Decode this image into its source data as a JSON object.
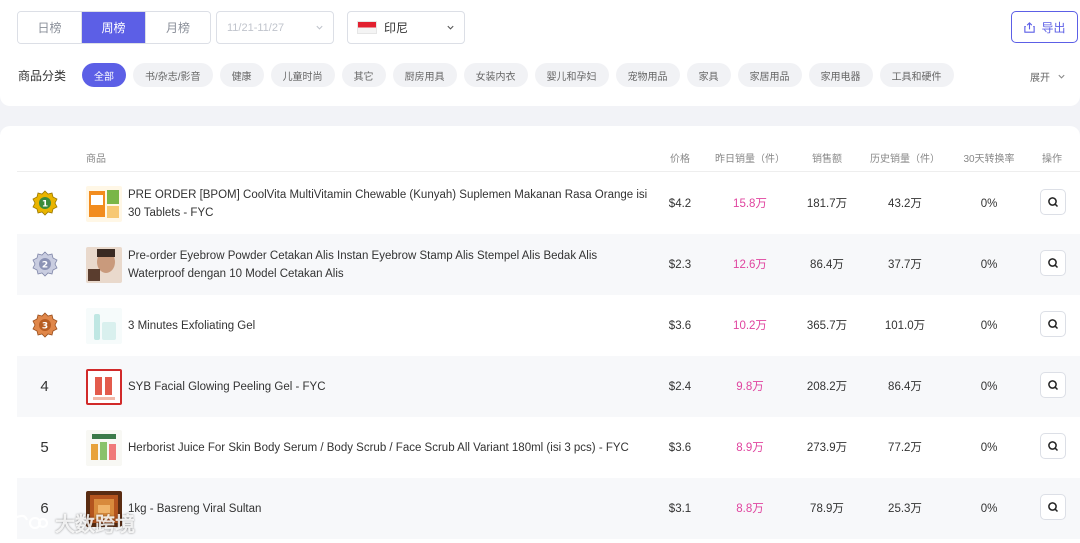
{
  "tabs": [
    {
      "label": "日榜",
      "active": false
    },
    {
      "label": "周榜",
      "active": true
    },
    {
      "label": "月榜",
      "active": false
    }
  ],
  "date_range": {
    "placeholder": "11/21-11/27"
  },
  "country": {
    "label": "印尼",
    "flag": "indonesia-flag"
  },
  "export_label": "导出",
  "category": {
    "label": "商品分类",
    "items": [
      "全部",
      "书/杂志/影音",
      "健康",
      "儿童时尚",
      "其它",
      "厨房用具",
      "女装内衣",
      "婴儿和孕妇",
      "宠物用品",
      "家具",
      "家居用品",
      "家用电器",
      "工具和硬件"
    ],
    "active_index": 0,
    "expand_label": "展开"
  },
  "table": {
    "headers": {
      "product": "商品",
      "price": "价格",
      "yesterday_sales": "昨日销量（件）",
      "revenue": "销售额",
      "history_sales": "历史销量（件）",
      "conversion": "30天转换率",
      "action": "操作"
    },
    "rows": [
      {
        "rank": "1",
        "medal": "gold",
        "title": "PRE ORDER [BPOM] CoolVita MultiVitamin Chewable (Kunyah) Suplemen Makanan Rasa Orange isi 30 Tablets - FYC",
        "price": "$4.2",
        "yesterday": "15.8万",
        "revenue": "181.7万",
        "history": "43.2万",
        "conversion": "0%"
      },
      {
        "rank": "2",
        "medal": "silver",
        "title": "Pre-order Eyebrow Powder Cetakan Alis Instan Eyebrow Stamp Alis Stempel Alis Bedak Alis Waterproof dengan 10 Model Cetakan Alis",
        "price": "$2.3",
        "yesterday": "12.6万",
        "revenue": "86.4万",
        "history": "37.7万",
        "conversion": "0%"
      },
      {
        "rank": "3",
        "medal": "bronze",
        "title": "3 Minutes Exfoliating Gel",
        "price": "$3.6",
        "yesterday": "10.2万",
        "revenue": "365.7万",
        "history": "101.0万",
        "conversion": "0%"
      },
      {
        "rank": "4",
        "medal": "",
        "title": "SYB Facial Glowing Peeling Gel - FYC",
        "price": "$2.4",
        "yesterday": "9.8万",
        "revenue": "208.2万",
        "history": "86.4万",
        "conversion": "0%"
      },
      {
        "rank": "5",
        "medal": "",
        "title": "Herborist Juice For Skin Body Serum / Body Scrub / Face Scrub All Variant 180ml (isi 3 pcs) - FYC",
        "price": "$3.6",
        "yesterday": "8.9万",
        "revenue": "273.9万",
        "history": "77.2万",
        "conversion": "0%"
      },
      {
        "rank": "6",
        "medal": "",
        "title": "1kg - Basreng Viral Sultan",
        "price": "$3.1",
        "yesterday": "8.8万",
        "revenue": "78.9万",
        "history": "25.3万",
        "conversion": "0%"
      }
    ]
  },
  "watermark": "大数跨境",
  "colors": {
    "accent": "#5c5fe6",
    "sales_pink": "#e0449f",
    "gold": "#d9a400",
    "silver": "#8c93b5",
    "bronze": "#c86a2c"
  }
}
